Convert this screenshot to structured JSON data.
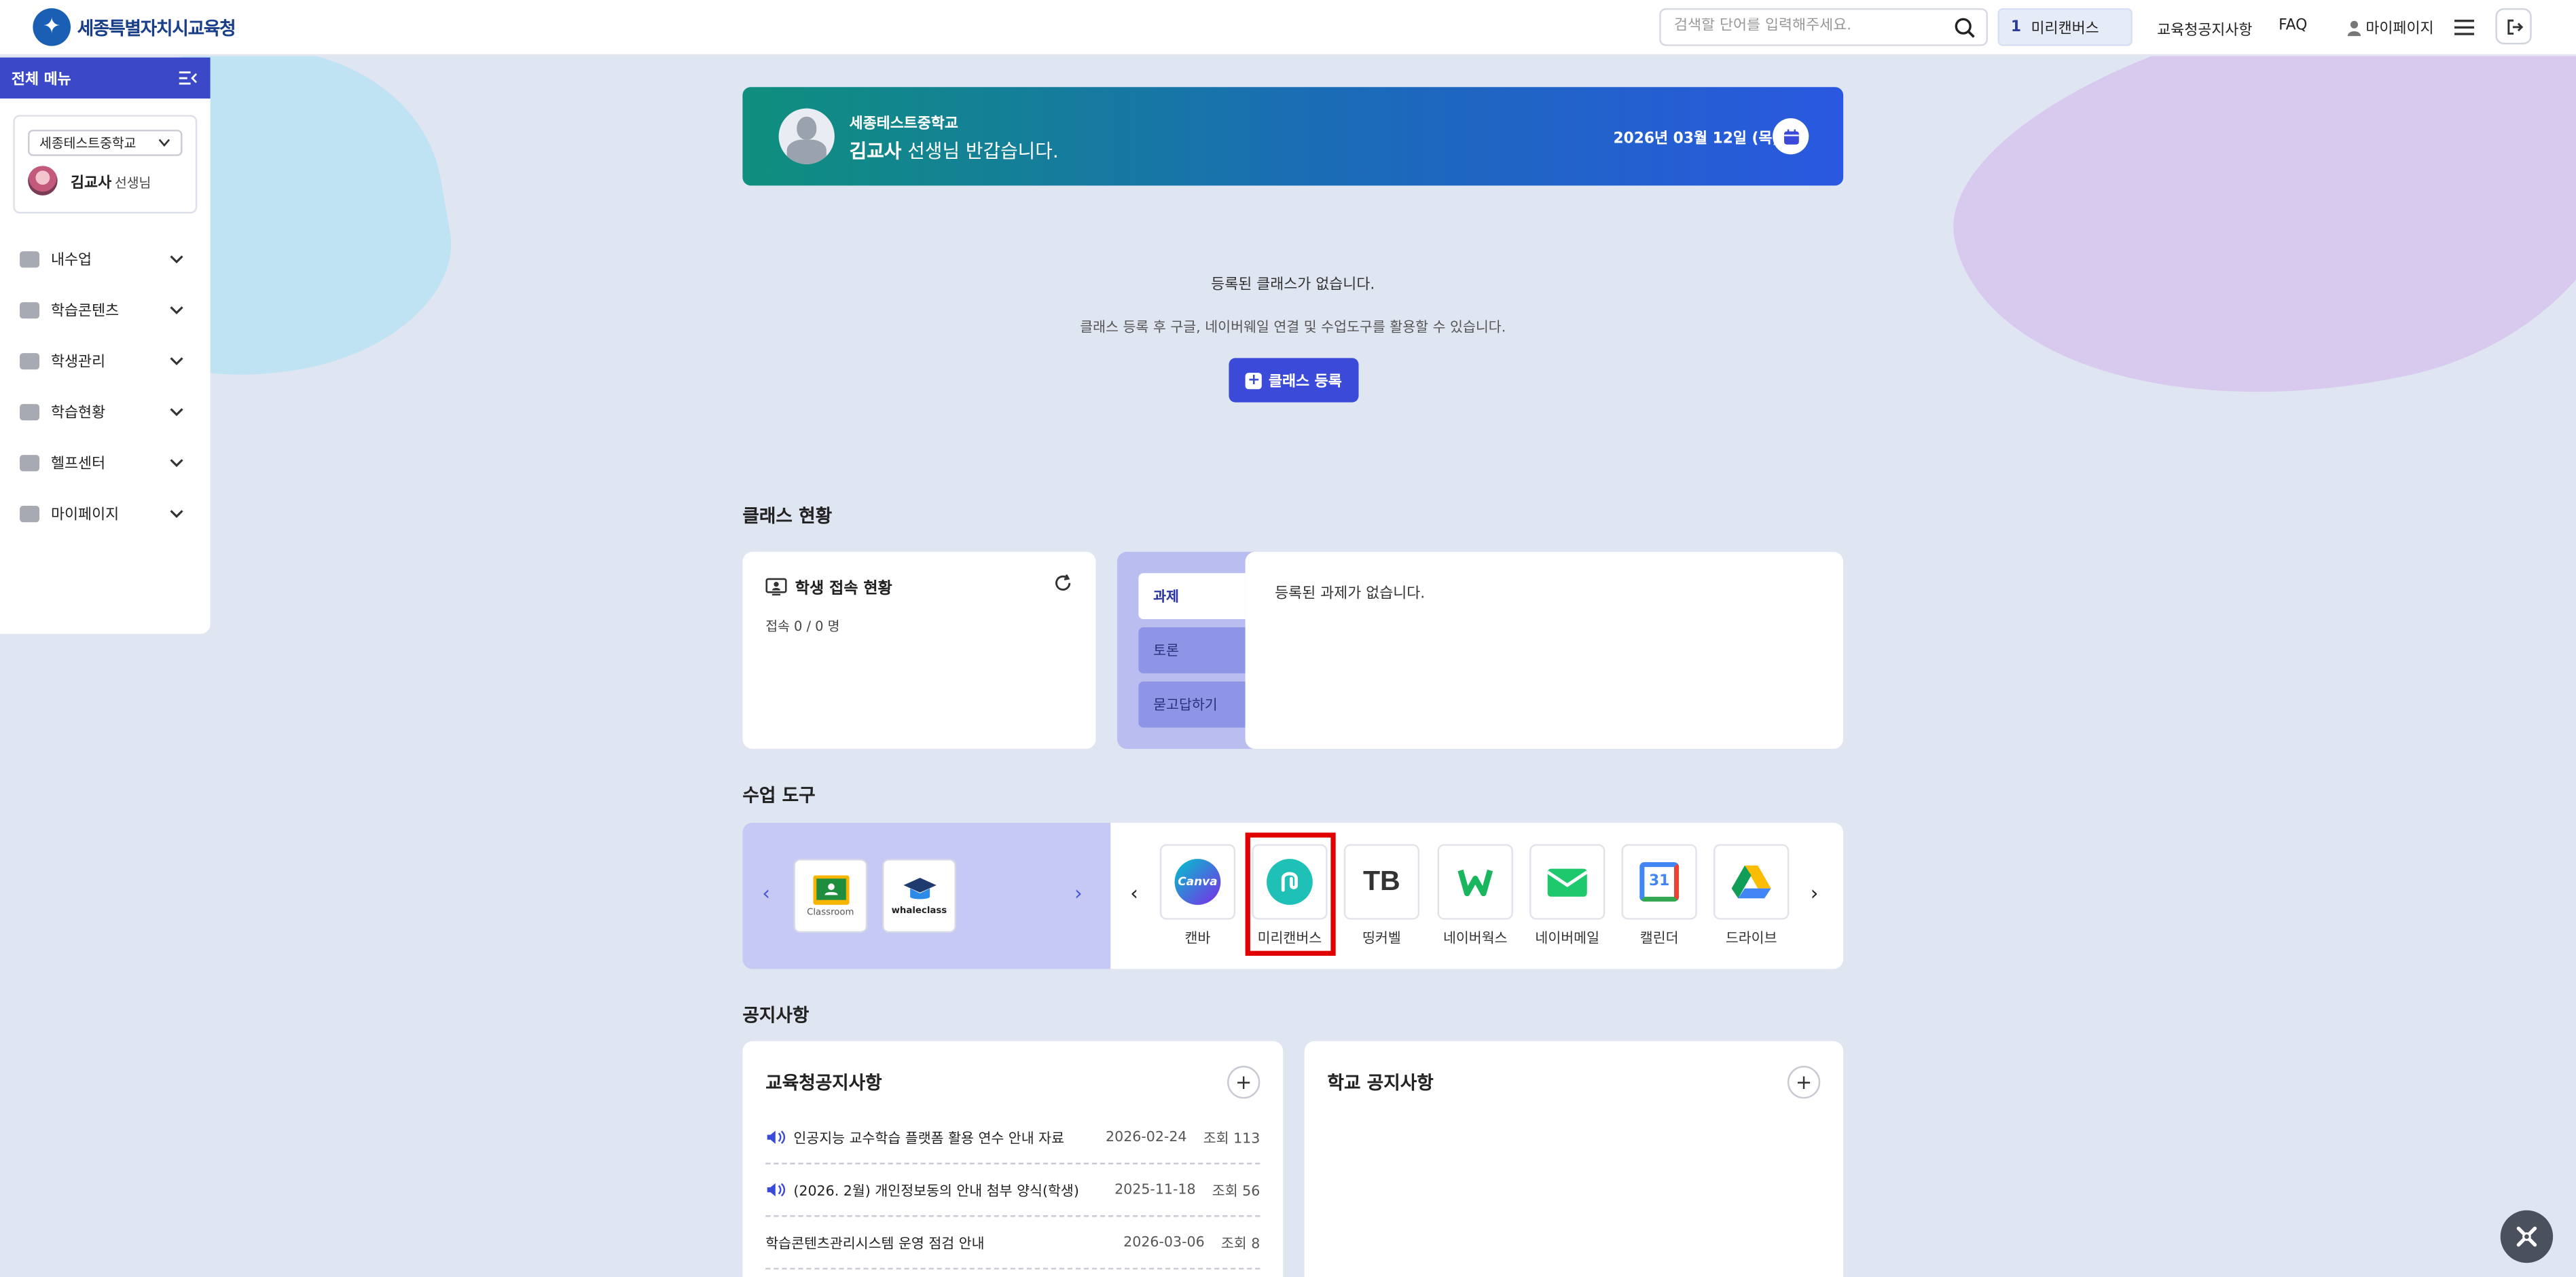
{
  "header": {
    "logo_text": "세종특별자치시교육청",
    "search_placeholder": "검색할 단어를 입력해주세요.",
    "rank": {
      "num": "1",
      "keyword": "미리캔버스"
    },
    "nav": [
      "교육청공지사항",
      "FAQ"
    ],
    "mypage_label": "마이페이지"
  },
  "sidebar": {
    "title": "전체 메뉴",
    "school": "세종테스트중학교",
    "teacher_name": "김교사",
    "teacher_role": "선생님",
    "items": [
      "내수업",
      "학습콘텐츠",
      "학생관리",
      "학습현황",
      "헬프센터",
      "마이페이지"
    ]
  },
  "welcome": {
    "school": "세종테스트중학교",
    "name": "김교사",
    "greeting": " 선생님 반갑습니다.",
    "date": "2026년 03월 12일 (목)"
  },
  "empty_class": {
    "line1": "등록된 클래스가 없습니다.",
    "line2": "클래스 등록 후 구글, 네이버웨일 연결 및 수업도구를 활용할 수 있습니다.",
    "button": "클래스 등록"
  },
  "class_status": {
    "title": "클래스 현황",
    "access_title": "학생 접속 현황",
    "access_count": "접속 0 / 0 명",
    "tabs": [
      "과제",
      "토론",
      "묻고답하기"
    ],
    "task_empty": "등록된 과제가 없습니다."
  },
  "tools": {
    "title": "수업 도구",
    "left_tiles": [
      "Classroom",
      "whaleclass"
    ],
    "items": [
      {
        "label": "캔바",
        "icon": "canva-icon"
      },
      {
        "label": "미리캔버스",
        "icon": "miricanvas-icon"
      },
      {
        "label": "띵커벨",
        "icon": "thinkerbell-icon"
      },
      {
        "label": "네이버웍스",
        "icon": "naverworks-icon"
      },
      {
        "label": "네이버메일",
        "icon": "navermail-icon"
      },
      {
        "label": "캘린더",
        "icon": "calendar-icon"
      },
      {
        "label": "드라이브",
        "icon": "drive-icon"
      }
    ],
    "canva_text": "Canva",
    "tb_text": "TB",
    "calendar_num": "31"
  },
  "notices": {
    "title": "공지사항",
    "office_title": "교육청공지사항",
    "school_title": "학교 공지사항",
    "rows": [
      {
        "title": "인공지능 교수학습 플랫폼 활용 연수 안내 자료",
        "date": "2026-02-24",
        "views": "조회 113",
        "speaker": true
      },
      {
        "title": "(2026. 2월) 개인정보동의 안내 첨부 양식(학생)",
        "date": "2025-11-18",
        "views": "조회 56",
        "speaker": true
      },
      {
        "title": "학습콘텐츠관리시스템 운영 점검 안내",
        "date": "2026-03-06",
        "views": "조회 8",
        "speaker": false
      }
    ]
  },
  "colors": {
    "primary": "#3b4ad8",
    "highlight": "#e00000"
  }
}
